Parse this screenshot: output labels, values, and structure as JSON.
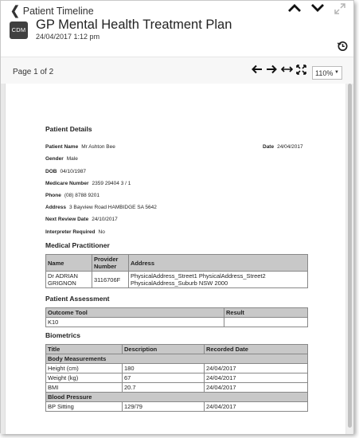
{
  "header": {
    "back_label": "Patient Timeline",
    "badge": "CDM",
    "title": "GP Mental Health Treatment Plan",
    "datetime": "24/04/2017 1:12 pm"
  },
  "toolbar": {
    "page_label": "Page 1 of 2",
    "zoom": "110%"
  },
  "document": {
    "patient_details": {
      "heading": "Patient Details",
      "name_label": "Patient Name",
      "name_value": "Mr Ashton Bee",
      "date_label": "Date",
      "date_value": "24/04/2017",
      "gender_label": "Gender",
      "gender_value": "Male",
      "dob_label": "DOB",
      "dob_value": "04/10/1987",
      "medicare_label": "Medicare Number",
      "medicare_value": "2359 29404 3 / 1",
      "phone_label": "Phone",
      "phone_value": "(08) 8788 9201",
      "address_label": "Address",
      "address_value": "3 Bayview Road HAMBIDGE SA 5642",
      "review_label": "Next Review Date",
      "review_value": "24/10/2017",
      "interpreter_label": "Interpreter Required",
      "interpreter_value": "No"
    },
    "medical_practitioner": {
      "heading": "Medical Practitioner",
      "col_name": "Name",
      "col_provider": "Provider Number",
      "col_address": "Address",
      "name": "Dr ADRIAN GRIGNON",
      "provider": "3116706F",
      "address_line1": "PhysicalAddress_Street1 PhysicalAddress_Street2",
      "address_line2": "PhysicalAddress_Suburb NSW 2000"
    },
    "patient_assessment": {
      "heading": "Patient Assessment",
      "col_tool": "Outcome Tool",
      "col_result": "Result",
      "tool": "K10",
      "result": ""
    },
    "biometrics": {
      "heading": "Biometrics",
      "col_title": "Title",
      "col_desc": "Description",
      "col_date": "Recorded Date",
      "group1": "Body Measurements",
      "rows1": [
        {
          "title": "Height (cm)",
          "desc": "180",
          "date": "24/04/2017"
        },
        {
          "title": "Weight (kg)",
          "desc": "67",
          "date": "24/04/2017"
        },
        {
          "title": "BMI",
          "desc": "20.7",
          "date": "24/04/2017"
        }
      ],
      "group2": "Blood Pressure",
      "rows2": [
        {
          "title": "BP Sitting",
          "desc": "129/79",
          "date": "24/04/2017"
        }
      ]
    }
  }
}
